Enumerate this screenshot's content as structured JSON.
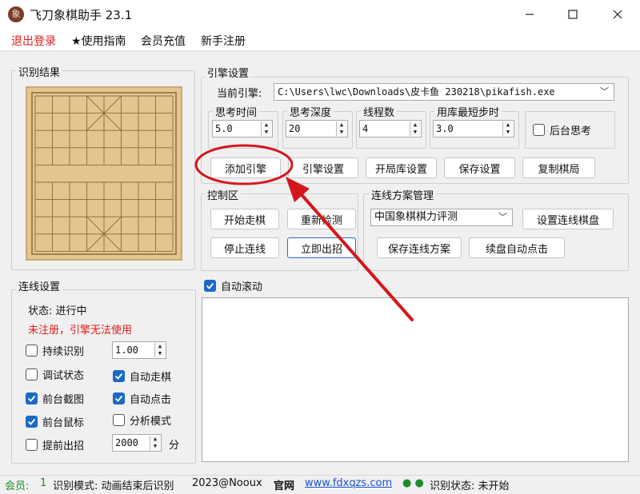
{
  "window": {
    "title": "飞刀象棋助手 23.1",
    "icon_char": "象",
    "controls": [
      "minimize-icon",
      "maximize-icon",
      "close-icon"
    ]
  },
  "menu": {
    "logout": "退出登录",
    "guide": "★使用指南",
    "recharge": "会员充值",
    "register": "新手注册"
  },
  "recognition": {
    "title": "识别结果"
  },
  "engine": {
    "title": "引擎设置",
    "current_label": "当前引擎:",
    "current_path": "C:\\Users\\lwc\\Downloads\\皮卡鱼 230218\\pikafish.exe",
    "think_time_label": "思考时间",
    "think_time": "5.0",
    "depth_label": "思考深度",
    "depth": "20",
    "threads_label": "线程数",
    "threads": "4",
    "min_step_label": "用库最短步时",
    "min_step": "3.0",
    "background_label": "后台思考",
    "buttons": {
      "add": "添加引擎",
      "settings": "引擎设置",
      "opening": "开局库设置",
      "save": "保存设置",
      "copy": "复制棋局"
    }
  },
  "control": {
    "title": "控制区",
    "start": "开始走棋",
    "redetect": "重新检测",
    "stop": "停止连线",
    "move_now": "立即出招"
  },
  "link_plan": {
    "title": "连线方案管理",
    "selected": "中国象棋棋力评测",
    "set_board": "设置连线棋盘",
    "save_plan": "保存连线方案",
    "auto_click": "续盘自动点击"
  },
  "conn": {
    "title": "连线设置",
    "status": "状态: 进行中",
    "warning": "未注册，引擎无法使用",
    "continuous": "持续识别",
    "interval": "1.00",
    "debug": "调试状态",
    "auto_move": "自动走棋",
    "fg_capture": "前台截图",
    "auto_click": "自动点击",
    "fg_mouse": "前台鼠标",
    "analysis": "分析模式",
    "early": "提前出招",
    "early_ms": "2000",
    "ms_unit": "分"
  },
  "log": {
    "auto_scroll": "自动滚动"
  },
  "status": {
    "member_label": "会员:",
    "member_value": "1",
    "mode": "识别模式: 动画结束后识别",
    "copyright": "2023@Nooux",
    "site_label": "官网",
    "site": "www.fdxqzs.com",
    "dots": "● ●",
    "recog_status": "识别状态: 未开始"
  },
  "colors": {
    "accent": "#1a69c7",
    "warning": "#e21b1b",
    "annotation": "#d4161c",
    "board": "#e3c590"
  }
}
